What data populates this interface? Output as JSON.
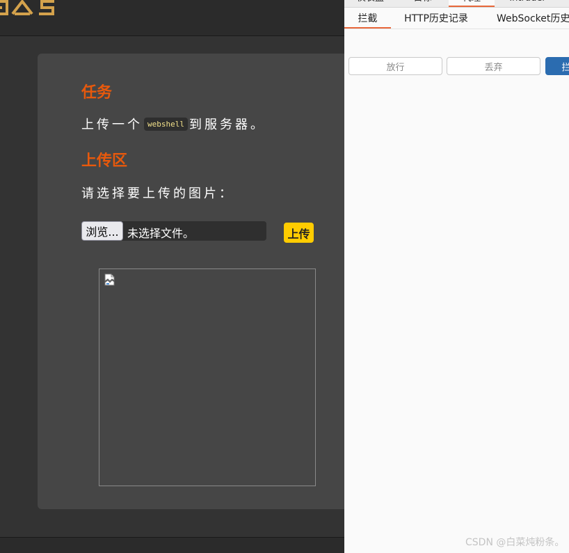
{
  "left_page": {
    "task": {
      "title": "任务",
      "text_before": "上传一个",
      "code": "webshell",
      "text_after": "到服务器。"
    },
    "upload_area": {
      "title": "上传区",
      "choose_label": "请选择要上传的图片：",
      "browse_label": "浏览...",
      "file_status": "未选择文件。",
      "upload_label": "上传"
    },
    "accent_color": "#e8590c",
    "upload_button_color": "#ffcc00"
  },
  "burp": {
    "top_tabs": [
      {
        "label": "仪表盘"
      },
      {
        "label": "目标"
      },
      {
        "label": "代理",
        "active": true
      },
      {
        "label": "Intruder"
      }
    ],
    "sub_tabs": [
      {
        "label": "拦截",
        "active": true
      },
      {
        "label": "HTTP历史记录"
      },
      {
        "label": "WebSocket历史"
      }
    ],
    "buttons": {
      "forward": "放行",
      "drop": "丢弃",
      "intercept": "拦"
    },
    "accent_color": "#e8673a",
    "primary_color": "#2b6cb0"
  },
  "watermark": "CSDN @白菜炖粉条。"
}
